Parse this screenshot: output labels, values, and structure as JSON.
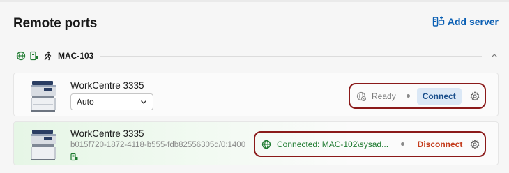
{
  "page": {
    "title": "Remote ports",
    "add_server_label": "Add server"
  },
  "group": {
    "name": "MAC-103",
    "icons": [
      "globe-icon",
      "network-port-icon",
      "running-person-icon"
    ],
    "expanded": true
  },
  "ports": [
    {
      "name": "WorkCentre 3335",
      "mode": "Auto",
      "status": "Ready",
      "action": "Connect",
      "connected": false
    },
    {
      "name": "WorkCentre 3335",
      "id": "b015f720-1872-4118-b555-fdb82556305d/0:1400",
      "status": "Connected:  MAC-102\\sysad...",
      "action": "Disconnect",
      "connected": true
    }
  ],
  "colors": {
    "accent": "#0a5fb4",
    "connected_text": "#1e7a30",
    "disconnect_text": "#c43c1c",
    "highlight_border": "#8b1a1a"
  }
}
